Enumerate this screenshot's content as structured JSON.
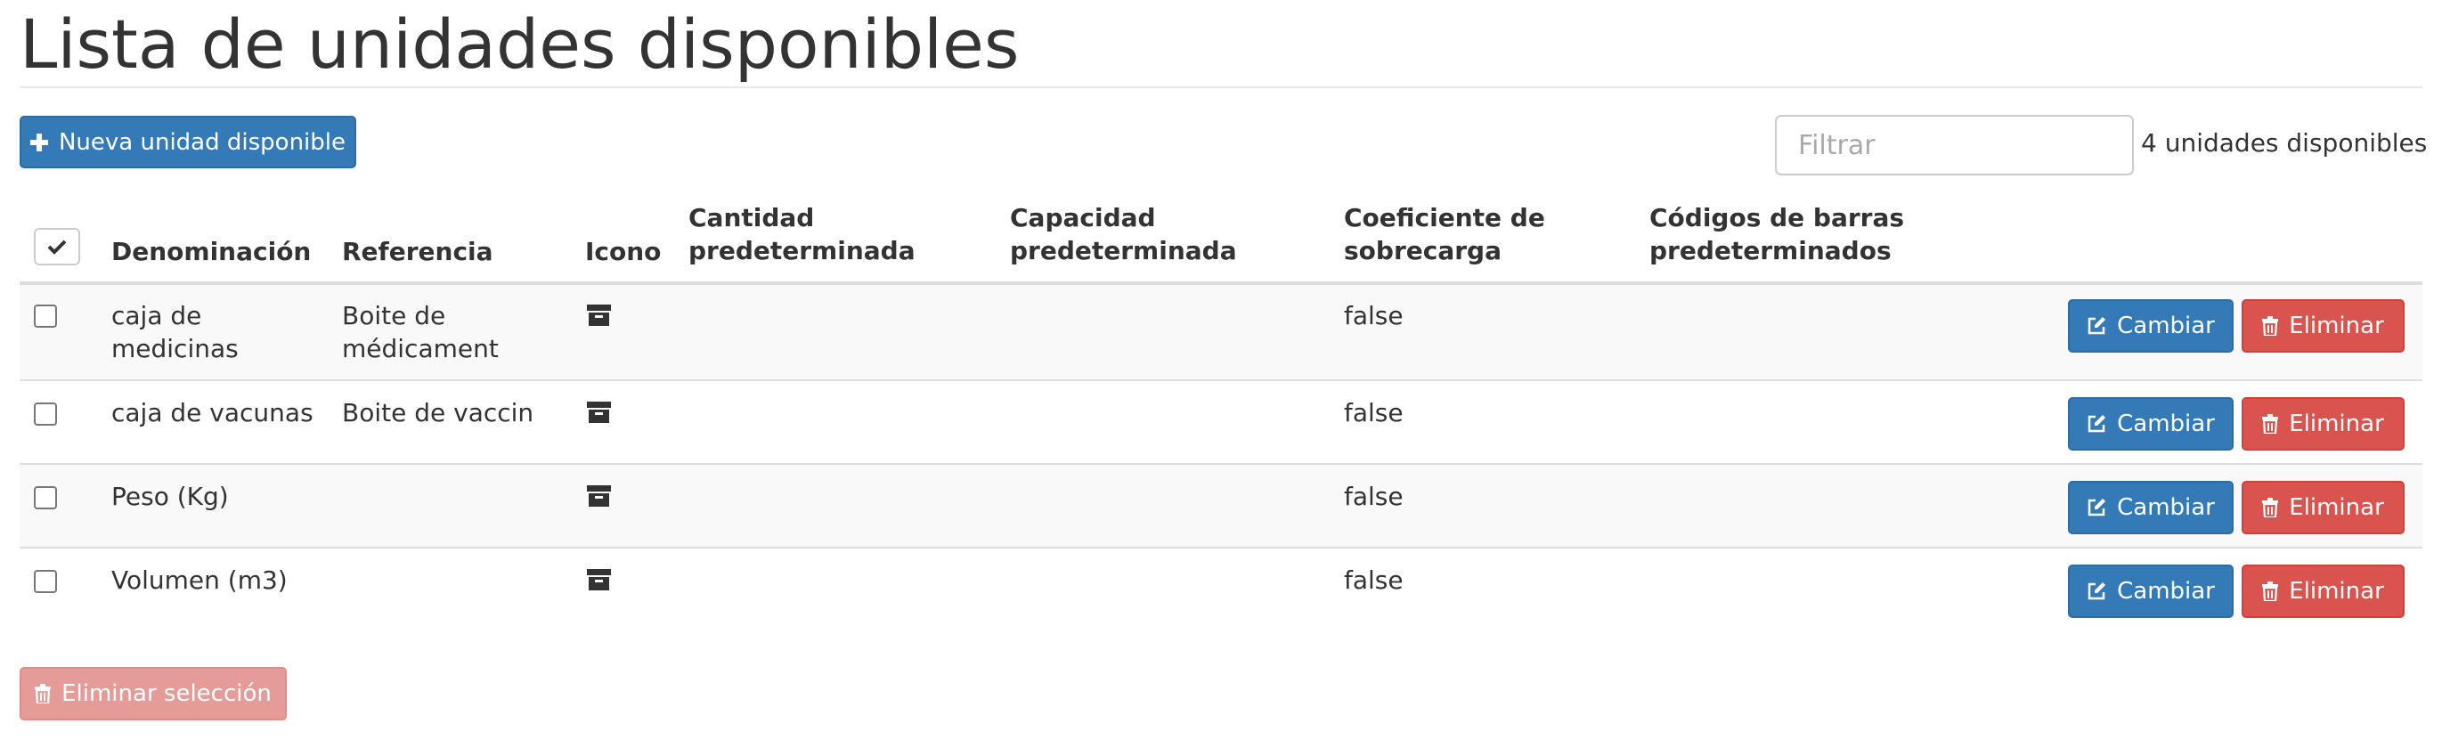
{
  "page": {
    "title": "Lista de unidades disponibles"
  },
  "toolbar": {
    "new_button_label": "Nueva unidad disponible",
    "filter_placeholder": "Filtrar",
    "filter_value": "",
    "count_text": "4 unidades disponibles"
  },
  "table": {
    "columns": {
      "name": "Denominación",
      "reference": "Referencia",
      "icon": "Icono",
      "default_quantity_1": "Cantidad",
      "default_quantity_2": "predeterminada",
      "default_capacity_1": "Capacidad",
      "default_capacity_2": "predeterminada",
      "overload_1": "Coeficiente de",
      "overload_2": "sobrecarga",
      "barcodes_1": "Códigos de barras",
      "barcodes_2": "predeterminados"
    },
    "rows": [
      {
        "name_1": "caja de",
        "name_2": "medicinas",
        "reference_1": "Boite de",
        "reference_2": "médicament",
        "icon": "archive-icon",
        "overload": "false",
        "checked": false
      },
      {
        "name_1": "caja de vacunas",
        "name_2": "",
        "reference_1": "Boite de vaccin",
        "reference_2": "",
        "icon": "archive-icon",
        "overload": "false",
        "checked": false
      },
      {
        "name_1": "Peso (Kg)",
        "name_2": "",
        "reference_1": "",
        "reference_2": "",
        "icon": "archive-icon",
        "overload": "false",
        "checked": false
      },
      {
        "name_1": "Volumen (m3)",
        "name_2": "",
        "reference_1": "",
        "reference_2": "",
        "icon": "archive-icon",
        "overload": "false",
        "checked": false
      }
    ],
    "edit_label": "Cambiar",
    "delete_label": "Eliminar"
  },
  "footer": {
    "bulk_delete_label": "Eliminar selección"
  },
  "colors": {
    "primary": "#337ab7",
    "danger": "#d9534f",
    "danger_disabled": "#e59b98",
    "row_stripe": "#f9f9f9"
  }
}
